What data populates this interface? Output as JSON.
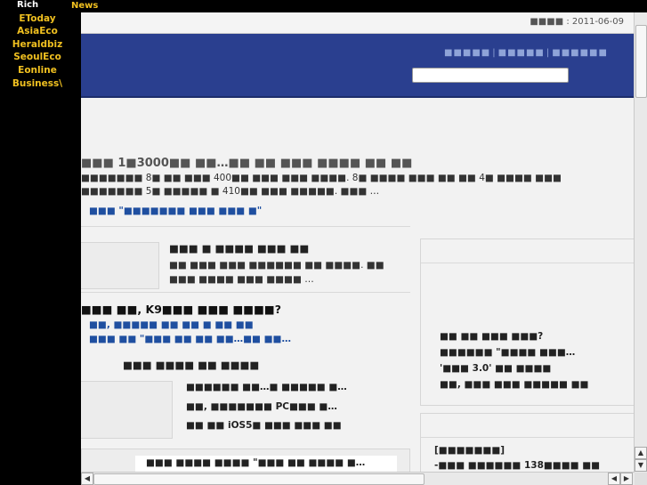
{
  "topbar": {
    "rich": "Rich",
    "news": "News"
  },
  "sidebar": [
    "EToday",
    "AsiaEco",
    "Heraldbiz",
    "SeoulEco",
    "Eonline",
    "Business\\"
  ],
  "header": {
    "date_label": "■■■■ : 2011-06-09",
    "nav": [
      "■■■■■",
      "■■■■■",
      "■■■■■■"
    ],
    "search_value": ""
  },
  "articles": {
    "headline": "■■■ 1■3000■■ ■■…■■ ■■ ■■■ ■■■■ ■■ ■■",
    "summary1": "■■■■■■■ 8■ ■■ ■■■ 400■■ ■■■ ■■■ ■■■■. 8■ ■■■■ ■■■ ■■ ■■ 4■ ■■■■ ■■■",
    "summary2": "■■■■■■■ 5■ ■■■■■ ■ 410■■ ■■■ ■■■■■. ■■■ …",
    "related": "■■■ \"■■■■■■■ ■■■ ■■■ ■\"",
    "story2_title": "■■■ ■ ■■■■ ■■■ ■■",
    "story2_line1": "■■ ■■■ ■■■ ■■■■■■ ■■ ■■■■. ■■",
    "story2_line2": "■■■ ■■■■ ■■■ ■■■■ …",
    "story3_title": "■■■ ■■, K9■■■ ■■■ ■■■■?",
    "story3_link1": "■■, ■■■■■ ■■ ■■ ■ ■■ ■■",
    "story3_link2": "■■■ ■■ \"■■■ ■■ ■■ ■■…■■ ■■…",
    "section_title": "■■■ ■■■■ ■■ ■■■■",
    "list1": "■■■■■■ ■■…■ ■■■■■ ■…",
    "list2": "■■, ■■■■■■■ PC■■■ ■…",
    "list3": "■■ ■■ iOS5■ ■■■ ■■■ ■■",
    "bottom_item": "■■■ ■■■■ ■■■■ \"■■■ ■■ ■■■■ ■…",
    "side1_1": "■■ ■■ ■■■ ■■■?",
    "side1_2": "■■■■■■ \"■■■■ ■■■…",
    "side1_3": "'■■■ 3.0' ■■ ■■■■",
    "side1_4": "■■, ■■■ ■■■ ■■■■■ ■■",
    "side2_head": "[■■■■■■■]",
    "side2_1": "-■■■ ■■■■■■ 138■■■■ ■■"
  }
}
